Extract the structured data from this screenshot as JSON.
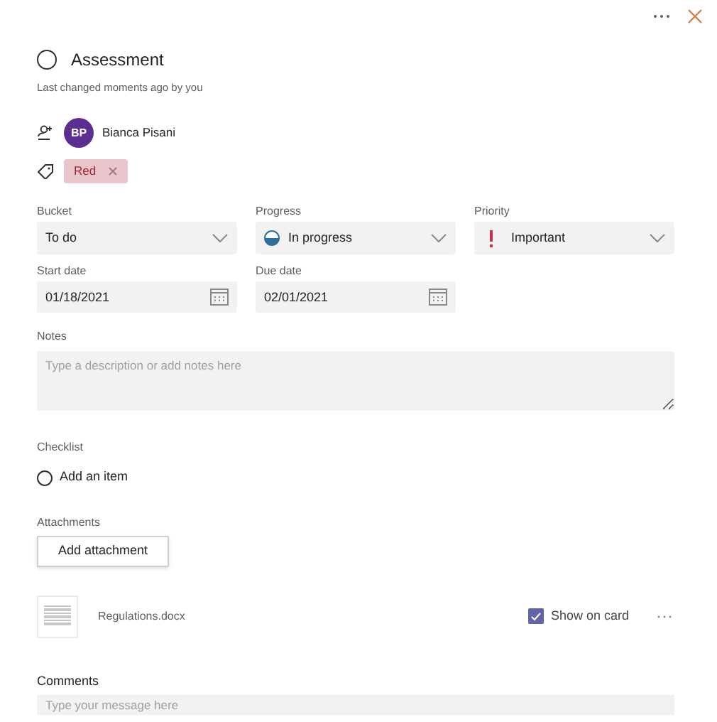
{
  "task": {
    "title": "Assessment",
    "completed": false,
    "subtitle": "Last changed moments ago by you"
  },
  "assignee": {
    "initials": "BP",
    "name": "Bianca Pisani"
  },
  "labels": [
    {
      "text": "Red",
      "color": "#e9c6cb"
    }
  ],
  "dropdowns": [
    {
      "label": "Bucket",
      "value": "To do",
      "kind": "plain"
    },
    {
      "label": "Progress",
      "value": "In progress",
      "kind": "progress"
    },
    {
      "label": "Priority",
      "value": "Important",
      "kind": "priority"
    }
  ],
  "dates": [
    {
      "label": "Start date",
      "value": "01/18/2021"
    },
    {
      "label": "Due date",
      "value": "02/01/2021"
    }
  ],
  "notes": {
    "label": "Notes",
    "placeholder": "Type a description or add notes here"
  },
  "checklist": {
    "label": "Checklist",
    "add_item": "Add an item"
  },
  "attachments": {
    "label": "Attachments",
    "button": "Add attachment",
    "files": [
      {
        "name": "Regulations.docx",
        "show_on_card_label": "Show on card",
        "show_on_card": true
      }
    ]
  },
  "comments": {
    "label": "Comments",
    "placeholder": "Type your message here"
  }
}
